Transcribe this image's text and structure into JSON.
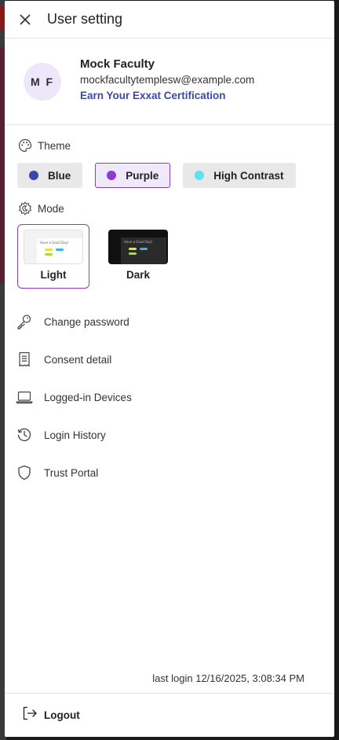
{
  "header": {
    "title": "User setting",
    "close_icon": "close-icon"
  },
  "profile": {
    "initials": "M F",
    "name": "Mock Faculty",
    "email": "mockfacultytemplesw@example.com",
    "certification_link": "Earn Your Exxat Certification"
  },
  "theme": {
    "label": "Theme",
    "options": [
      {
        "label": "Blue",
        "color": "#3846a8",
        "selected": false
      },
      {
        "label": "Purple",
        "color": "#8e3bd6",
        "selected": true
      },
      {
        "label": "High Contrast",
        "color": "#5ce3f2",
        "selected": false
      }
    ]
  },
  "mode": {
    "label": "Mode",
    "preview_text": "Have a Good Day!",
    "options": [
      {
        "label": "Light",
        "selected": true
      },
      {
        "label": "Dark",
        "selected": false
      }
    ]
  },
  "menu": [
    {
      "label": "Change password",
      "icon": "key-icon"
    },
    {
      "label": "Consent detail",
      "icon": "receipt-icon"
    },
    {
      "label": "Logged-in Devices",
      "icon": "laptop-icon"
    },
    {
      "label": "Login History",
      "icon": "history-icon"
    },
    {
      "label": "Trust Portal",
      "icon": "shield-icon"
    }
  ],
  "last_login": "last login 12/16/2025, 3:08:34 PM",
  "logout": {
    "label": "Logout",
    "icon": "logout-icon"
  },
  "colors": {
    "accent": "#8e3bc7",
    "link": "#3b4aa8"
  }
}
